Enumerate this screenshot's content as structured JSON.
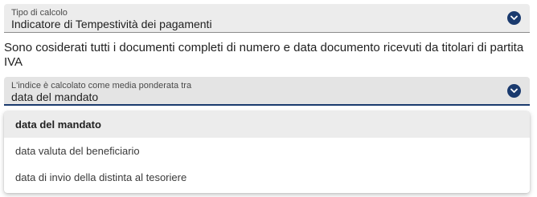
{
  "calc_type": {
    "label": "Tipo di calcolo",
    "value": "Indicatore di Tempestività dei pagamenti"
  },
  "description": "Sono cosiderati tutti i documenti completi di numero e data documento ricevuti da titolari di partita IVA",
  "weighted_average": {
    "label": "L'indice è calcolato come media ponderata tra",
    "value": "data del mandato"
  },
  "dropdown": {
    "options": [
      {
        "label": "data del mandato",
        "selected": true
      },
      {
        "label": "data valuta del beneficiario",
        "selected": false
      },
      {
        "label": "data di invio della distinta al tesoriere",
        "selected": false
      }
    ]
  },
  "colors": {
    "accent": "#1a3a6e",
    "field_bg": "#ececec"
  },
  "icons": {
    "dropdown": "chevron-down-icon"
  }
}
